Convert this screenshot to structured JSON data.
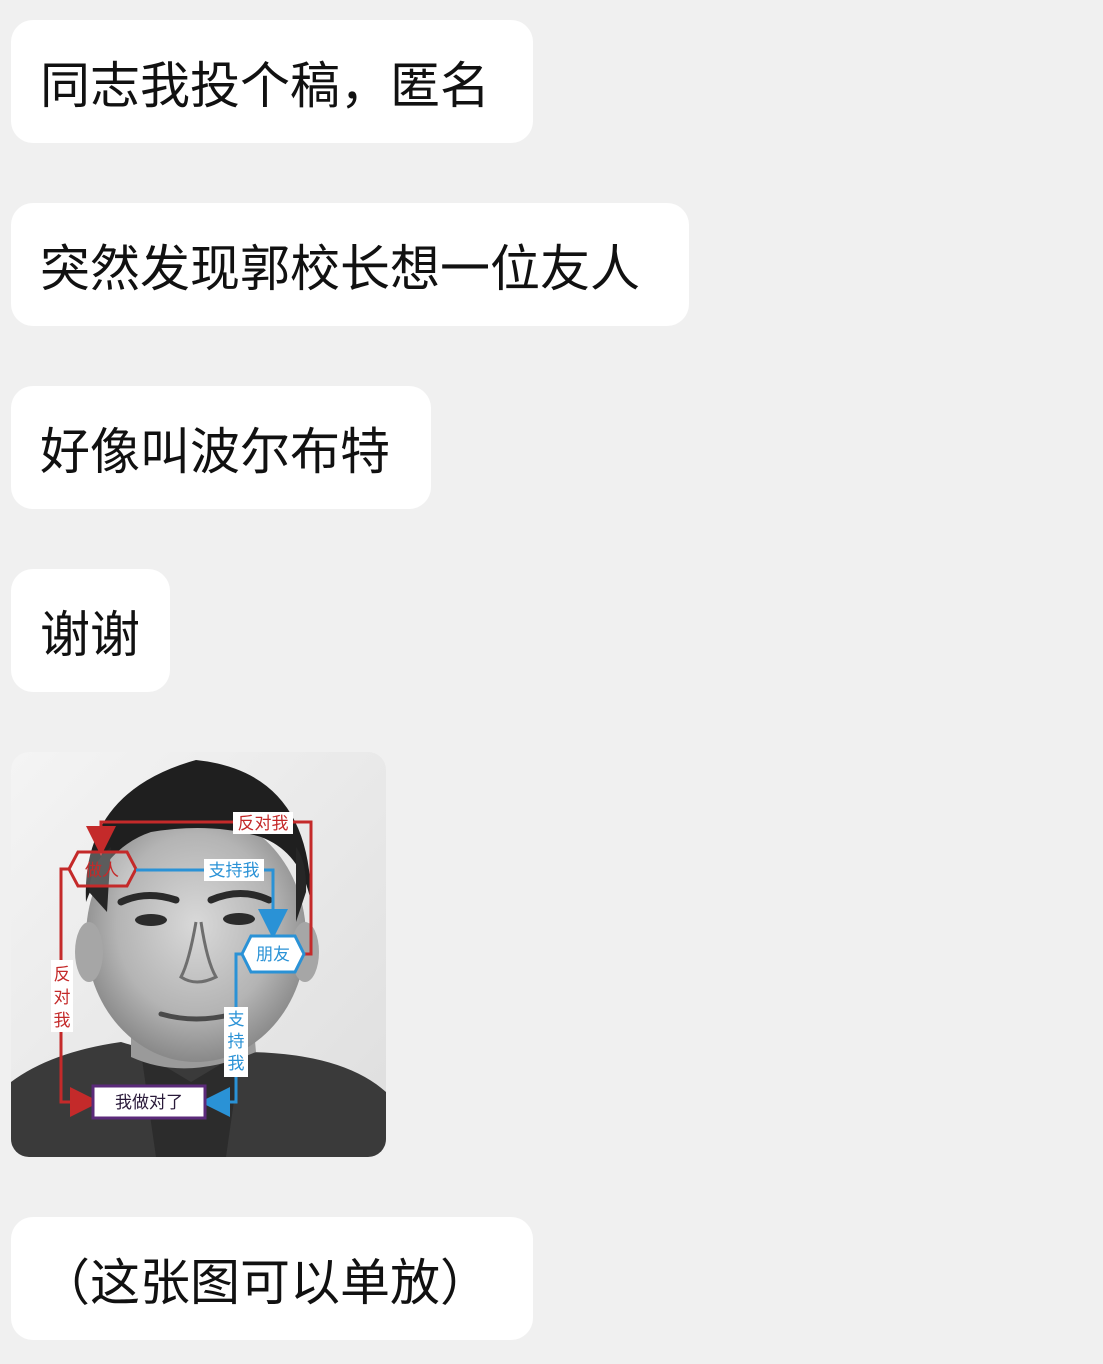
{
  "messages": [
    {
      "text": "同志我投个稿，匿名"
    },
    {
      "text": "突然发现郭校长想一位友人"
    },
    {
      "text": "好像叫波尔布特"
    },
    {
      "text": "谢谢"
    },
    {
      "image": {
        "labels": {
          "oppose_top": "反对我",
          "person": "做人",
          "support_right": "支持我",
          "friend": "朋友",
          "oppose_left": [
            "反",
            "对",
            "我"
          ],
          "support_vertical": [
            "支",
            "持",
            "我"
          ],
          "result": "我做对了"
        },
        "colors": {
          "oppose": "#c42a2a",
          "support": "#2a92d6"
        }
      }
    },
    {
      "text": "（这张图可以单放）"
    }
  ]
}
